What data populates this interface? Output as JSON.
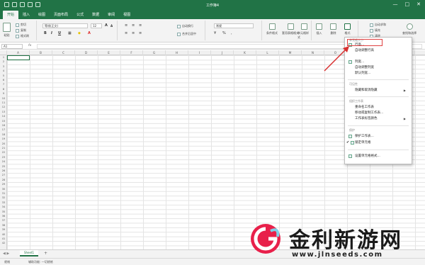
{
  "window": {
    "title": "工作簿4",
    "controls": [
      "—",
      "□",
      "✕"
    ]
  },
  "tabs": [
    "开始",
    "插入",
    "绘图",
    "页面布局",
    "公式",
    "数据",
    "审阅",
    "视图"
  ],
  "ribbon": {
    "paste": "粘贴",
    "cut": "剪切",
    "copy": "复制",
    "format_painter": "格式刷",
    "font_name": "等线(正文)",
    "font_size": "12",
    "bold": "B",
    "italic": "I",
    "underline": "U",
    "wrap_text": "自动换行",
    "merge_center": "合并后居中",
    "number_format": "常规",
    "conditional_formatting": "条件格式",
    "format_as_table": "套用表格格式",
    "cell_styles": "单元格样式",
    "insert": "插入",
    "delete": "删除",
    "format": "格式",
    "autosum": "自动求和",
    "fill": "填充",
    "clear": "清除",
    "sort_filter": "排序和筛选",
    "find_select": "查找和选择"
  },
  "formula_bar": {
    "name_box": "A1",
    "fx": "fx"
  },
  "grid": {
    "columns": [
      "A",
      "B",
      "C",
      "D",
      "E",
      "F",
      "G",
      "H",
      "I",
      "J",
      "K",
      "L",
      "M",
      "N",
      "O",
      "P",
      "Q",
      "R"
    ],
    "rows": [
      "1",
      "2",
      "3",
      "4",
      "5",
      "6",
      "7",
      "8",
      "9",
      "10",
      "11",
      "12",
      "13",
      "14",
      "15",
      "16",
      "17",
      "18",
      "19",
      "20",
      "21",
      "22",
      "23",
      "24",
      "25",
      "26",
      "27",
      "28",
      "29",
      "30",
      "31",
      "32",
      "33",
      "34",
      "35",
      "36",
      "37",
      "38",
      "39",
      "40",
      "41",
      "42"
    ]
  },
  "format_menu": {
    "section_cell_size": "单元格大小",
    "row_height": "行高...",
    "autofit_row_height": "自动调整行高",
    "column_width": "列宽...",
    "autofit_column_width": "自动调整列宽",
    "default_width": "默认列宽...",
    "section_visibility": "可见性",
    "hide_unhide": "隐藏和取消隐藏",
    "section_organize": "组织工作表",
    "rename_sheet": "重命名工作表",
    "move_copy_sheet": "移动或复制工作表...",
    "tab_color": "工作表标签颜色",
    "section_protection": "保护",
    "protect_sheet": "保护工作表...",
    "lock_cell": "锁定单元格",
    "format_cells": "设置单元格格式..."
  },
  "sheets": {
    "nav": "◀ ▶",
    "active": "Sheet1",
    "add": "+"
  },
  "status": {
    "ready": "就绪",
    "accessibility": "辅助功能: 一切就绪"
  },
  "watermark": {
    "cn": "金利新游网",
    "url": "www.jlnseeds.com"
  },
  "colors": {
    "accent": "#217346",
    "highlight": "#e04040"
  }
}
